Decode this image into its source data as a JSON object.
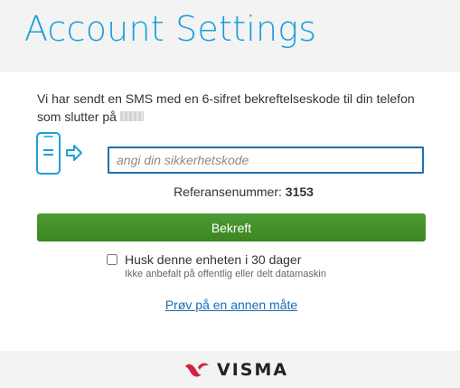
{
  "header": {
    "title": "Account Settings"
  },
  "verification": {
    "message": "Vi har sendt en SMS med en 6-sifret bekreftelseskode til din telefon som slutter på",
    "code_placeholder": "angi din sikkerhetskode",
    "code_value": "",
    "reference_label": "Referansenummer:",
    "reference_number": "3153",
    "confirm_label": "Bekreft",
    "remember_label": "Husk denne enheten i 30 dager",
    "remember_checked": false,
    "remember_hint": "Ikke anbefalt på offentlig eller delt datamaskin",
    "alt_method_label": "Prøv på en annen måte"
  },
  "icons": {
    "phone": "phone-send-code-icon",
    "logo_mark": "visma-logo-mark"
  },
  "colors": {
    "title": "#1aa0d9",
    "icon": "#1aa0d9",
    "input_border": "#1f6fb0",
    "confirm_button": "#3f8a25",
    "link": "#1a6db5",
    "logo_mark": "#d4213d",
    "background_band": "#f3f3f3"
  },
  "footer": {
    "logo_text": "VISMA"
  }
}
